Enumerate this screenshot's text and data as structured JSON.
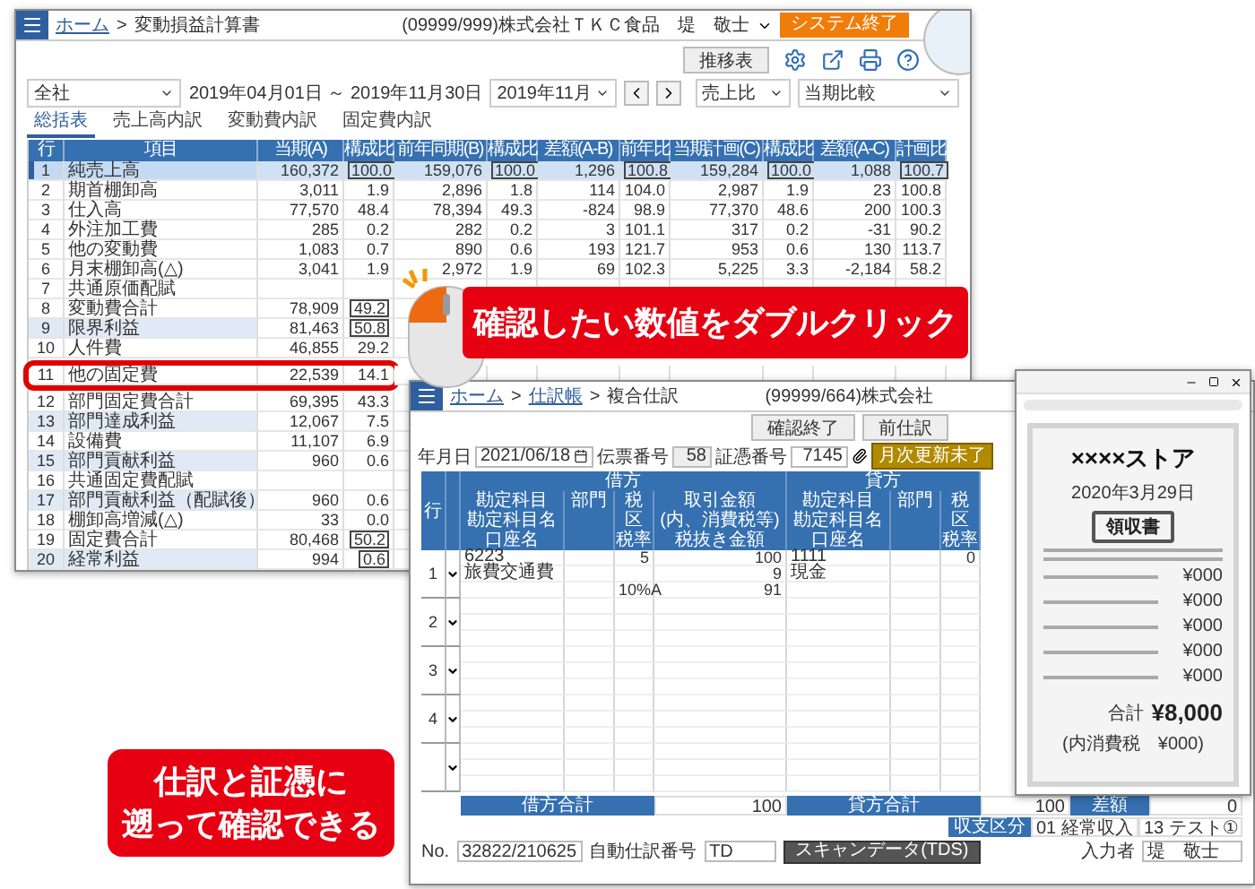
{
  "back_window": {
    "breadcrumb": {
      "home": "ホーム",
      "separator": ">",
      "current": "変動損益計算書"
    },
    "user": "(09999/999)株式会社ＴＫＣ食品　堤　敬士",
    "exit_button": "システム終了",
    "transition_button": "推移表",
    "filters": {
      "division": "全社",
      "period": "2019年04月01日 ～ 2019年11月30日",
      "month": "2019年11月",
      "ratio": "売上比",
      "comparison": "当期比較"
    },
    "tabs": [
      {
        "label": "総括表",
        "selected": true
      },
      {
        "label": "売上高内訳",
        "selected": false
      },
      {
        "label": "変動費内訳",
        "selected": false
      },
      {
        "label": "固定費内訳",
        "selected": false
      }
    ],
    "table": {
      "columns": [
        "行",
        "項目",
        "当期(A)",
        "構成比",
        "前年同期(B)",
        "構成比",
        "差額(A-B)",
        "前年比",
        "当期計画(C)",
        "構成比",
        "差額(A-C)",
        "計画比"
      ],
      "rows": [
        {
          "no": "1",
          "item": "純売上高",
          "values": [
            "160,372",
            "100.0",
            "159,076",
            "100.0",
            "1,296",
            "100.8",
            "159,284",
            "100.0",
            "1,088",
            "100.7"
          ],
          "selected": true,
          "shaded": true,
          "boxed": true,
          "highlighted": false
        },
        {
          "no": "2",
          "item": "期首棚卸高",
          "values": [
            "3,011",
            "1.9",
            "2,896",
            "1.8",
            "114",
            "104.0",
            "2,987",
            "1.9",
            "23",
            "100.8"
          ],
          "selected": false,
          "shaded": false,
          "boxed": false,
          "highlighted": false
        },
        {
          "no": "3",
          "item": "仕入高",
          "values": [
            "77,570",
            "48.4",
            "78,394",
            "49.3",
            "-824",
            "98.9",
            "77,370",
            "48.6",
            "200",
            "100.3"
          ],
          "selected": false,
          "shaded": false,
          "boxed": false,
          "highlighted": false
        },
        {
          "no": "4",
          "item": "外注加工費",
          "values": [
            "285",
            "0.2",
            "282",
            "0.2",
            "3",
            "101.1",
            "317",
            "0.2",
            "-31",
            "90.2"
          ],
          "selected": false,
          "shaded": false,
          "boxed": false,
          "highlighted": false
        },
        {
          "no": "5",
          "item": "他の変動費",
          "values": [
            "1,083",
            "0.7",
            "890",
            "0.6",
            "193",
            "121.7",
            "953",
            "0.6",
            "130",
            "113.7"
          ],
          "selected": false,
          "shaded": false,
          "boxed": false,
          "highlighted": false
        },
        {
          "no": "6",
          "item": "月末棚卸高(△)",
          "values": [
            "3,041",
            "1.9",
            "2,972",
            "1.9",
            "69",
            "102.3",
            "5,225",
            "3.3",
            "-2,184",
            "58.2"
          ],
          "selected": false,
          "shaded": false,
          "boxed": false,
          "highlighted": false
        },
        {
          "no": "7",
          "item": "共通原価配賦",
          "values": [],
          "selected": false,
          "shaded": false,
          "highlighted": false
        },
        {
          "no": "8",
          "item": "変動費合計",
          "values": [
            "78,909",
            "49.2"
          ],
          "selected": false,
          "shaded": false,
          "boxed": true,
          "highlighted": false
        },
        {
          "no": "9",
          "item": "限界利益",
          "values": [
            "81,463",
            "50.8"
          ],
          "selected": false,
          "shaded": true,
          "boxed": true,
          "highlighted": false
        },
        {
          "no": "10",
          "item": "人件費",
          "values": [
            "46,855",
            "29.2"
          ],
          "selected": false,
          "shaded": false,
          "boxed": false,
          "highlighted": false
        },
        {
          "no": "11",
          "item": "他の固定費",
          "values": [
            "22,539",
            "14.1"
          ],
          "selected": false,
          "shaded": false,
          "boxed": false,
          "highlighted": true
        },
        {
          "no": "12",
          "item": "部門固定費合計",
          "values": [
            "69,395",
            "43.3"
          ],
          "selected": false,
          "shaded": false,
          "boxed": false,
          "highlighted": false
        },
        {
          "no": "13",
          "item": "部門達成利益",
          "values": [
            "12,067",
            "7.5"
          ],
          "selected": false,
          "shaded": true,
          "boxed": false,
          "highlighted": false
        },
        {
          "no": "14",
          "item": "設備費",
          "values": [
            "11,107",
            "6.9"
          ],
          "selected": false,
          "shaded": false,
          "boxed": false,
          "highlighted": false
        },
        {
          "no": "15",
          "item": "部門貢献利益",
          "values": [
            "960",
            "0.6"
          ],
          "selected": false,
          "shaded": true,
          "boxed": false,
          "highlighted": false
        },
        {
          "no": "16",
          "item": "共通固定費配賦",
          "values": [],
          "selected": false,
          "shaded": false,
          "highlighted": false
        },
        {
          "no": "17",
          "item": "部門貢献利益（配賦後）",
          "values": [
            "960",
            "0.6"
          ],
          "selected": false,
          "shaded": true,
          "boxed": false,
          "highlighted": false
        },
        {
          "no": "18",
          "item": "棚卸高増減(△)",
          "values": [
            "33",
            "0.0"
          ],
          "selected": false,
          "shaded": false,
          "boxed": false,
          "highlighted": false
        },
        {
          "no": "19",
          "item": "固定費合計",
          "values": [
            "80,468",
            "50.2"
          ],
          "selected": false,
          "shaded": false,
          "boxed": true,
          "highlighted": false
        },
        {
          "no": "20",
          "item": "経常利益",
          "values": [
            "994",
            "0.6"
          ],
          "selected": false,
          "shaded": true,
          "boxed": true,
          "highlighted": false
        }
      ]
    }
  },
  "callouts": [
    {
      "kind": "top",
      "lines": [
        "確認したい数値をダブルクリック"
      ]
    },
    {
      "kind": "bottom",
      "lines": [
        "仕訳と証憑に",
        "遡って確認できる"
      ]
    }
  ],
  "journal_window": {
    "breadcrumb": {
      "home": "ホーム",
      "separator": ">",
      "ledger": "仕訳帳",
      "separator_2": ">",
      "current": "複合仕訳"
    },
    "company": "(99999/664)株式会社",
    "buttons": [
      "確認終了",
      "前仕訳"
    ],
    "fields": {
      "date_label": "年月日",
      "date": "2021/06/18",
      "slip_label": "伝票番号",
      "slip": "58",
      "voucher_label": "証憑番号",
      "voucher": "7145",
      "status": "月次更新未了"
    },
    "table": {
      "row_header": "行",
      "debit": "借方",
      "credit": "貸方",
      "header_columns": [
        [
          "勘定科目",
          "勘定科目名",
          "口座名"
        ],
        [
          "部門"
        ],
        [
          "税",
          "区",
          "税率"
        ],
        [
          "取引金額",
          "(内、消費税等)",
          "税抜き金額"
        ],
        [
          "勘定科目",
          "勘定科目名",
          "口座名"
        ],
        [
          "部門"
        ],
        [
          "税",
          "区",
          "税率"
        ]
      ],
      "rows": [
        {
          "no": "1",
          "lines": [
            {
              "debit_account": "6223",
              "debit_tax": "5",
              "debit_amount": "100",
              "credit_account": "1111",
              "credit_tax": "0"
            },
            {
              "debit_account": "旅費交通費",
              "debit_amount": "9",
              "credit_account": "現金"
            },
            {
              "debit_tax": "10%A",
              "debit_amount": "91"
            }
          ]
        },
        {
          "no": "2"
        },
        {
          "no": "3"
        },
        {
          "no": "4"
        },
        {}
      ]
    },
    "totals": {
      "debit_label": "借方合計",
      "debit": "100",
      "credit_label": "貸方合計",
      "credit": "100",
      "diff_label": "差額",
      "diff": "0",
      "category_label": "収支区分",
      "category": "01 経常収入",
      "tag": "13 テスト①"
    },
    "status": {
      "no_label": "No.",
      "no": "32822/210625",
      "auto_label": "自動仕訳番号",
      "auto": "TD",
      "scan_button": "スキャンデータ(TDS)",
      "inputter_label": "入力者",
      "inputter": "堤　敬士"
    }
  },
  "receipt_window": {
    "store": "××××ストア",
    "date": "2020年3月29日",
    "title": "領収書",
    "items": [
      "¥000",
      "¥000",
      "¥000",
      "¥000",
      "¥000"
    ],
    "total_label": "合計",
    "total": "¥8,000",
    "tax": "(内消費税　¥000)"
  }
}
